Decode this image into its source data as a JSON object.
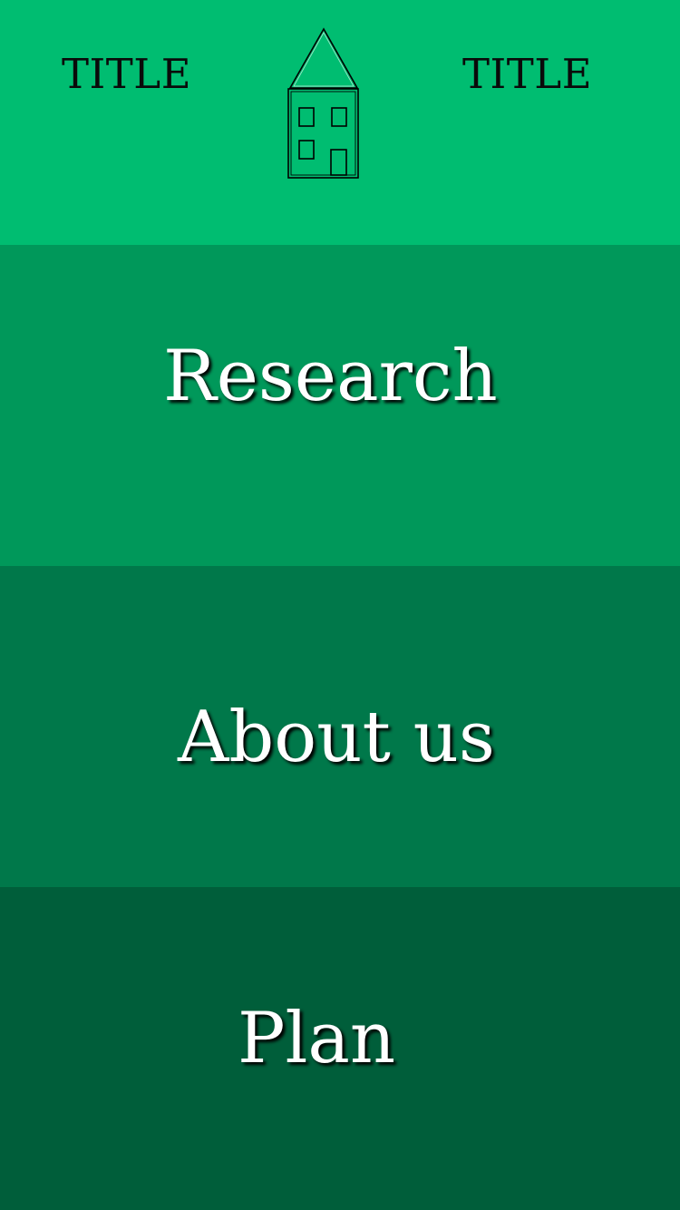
{
  "header": {
    "left_title": "TITLE",
    "right_title": "TITLE",
    "logo_icon": "house-icon",
    "background": "#00bd71"
  },
  "sections": [
    {
      "label": "Research",
      "background": "#00985a"
    },
    {
      "label": "About us",
      "background": "#00784a"
    },
    {
      "label": "Plan",
      "background": "#005e3a"
    }
  ],
  "text_color": "#ffffff",
  "header_text_color": "#0a0a0a"
}
